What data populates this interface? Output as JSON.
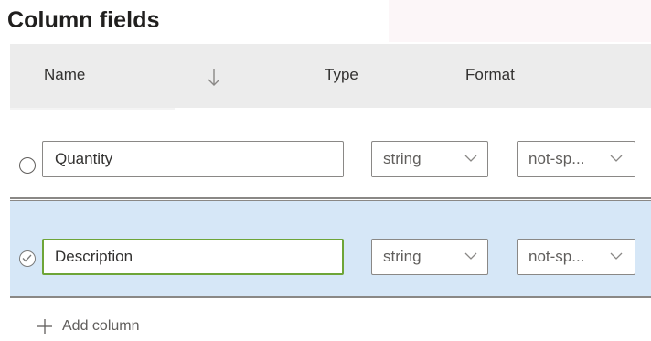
{
  "title": "Column fields",
  "headers": {
    "name": "Name",
    "type": "Type",
    "format": "Format"
  },
  "rows": [
    {
      "name": "Quantity",
      "type": "string",
      "format": "not-sp...",
      "selected": false
    },
    {
      "name": "Description",
      "type": "string",
      "format": "not-sp...",
      "selected": true
    }
  ],
  "add_column_label": "Add column",
  "icons": {
    "sort": "arrow-down-icon",
    "dropdown": "chevron-down-icon",
    "add": "plus-icon",
    "selected": "checkmark-icon"
  },
  "colors": {
    "header_bg": "#ececec",
    "selected_row_bg": "#d6e7f7",
    "focus_border": "#6ea538"
  }
}
